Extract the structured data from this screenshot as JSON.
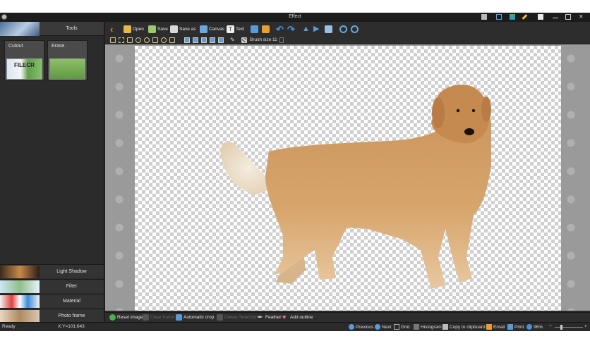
{
  "window": {
    "title": "Effect"
  },
  "sidebar": {
    "tools_label": "Tools",
    "cards": [
      {
        "label": "Cutout",
        "watermark": "FILECR"
      },
      {
        "label": "Erase"
      }
    ],
    "bottom_items": [
      {
        "label": "Light Shadow"
      },
      {
        "label": "Filter"
      },
      {
        "label": "Material"
      },
      {
        "label": "Photo frame"
      }
    ]
  },
  "toolbar": {
    "open": "Open",
    "save": "Save",
    "save_as": "Save as",
    "canvas": "Canvas",
    "text": "Text",
    "brush_size_label": "Brush size",
    "brush_size_value": "11"
  },
  "bottom_actions": {
    "reset": "Reset image",
    "clear_frame": "Clear frame",
    "auto_crop": "Automatic crop",
    "delete_selection": "Delete Selection",
    "feather": "Feather",
    "add_outline": "Add outline"
  },
  "status": {
    "ready": "Ready",
    "coords": "X:Y=101:643",
    "previous": "Previous",
    "next": "Next",
    "grid": "Grid",
    "histogram": "Histogram",
    "copy": "Copy to clipboard",
    "email": "Email",
    "print": "Print",
    "zoom": "96%",
    "zoom_level": 0.2
  },
  "colors": {
    "accent_orange": "#e08a2a",
    "blue_icon": "#4a8fd8",
    "bg": "#2a2a2a"
  }
}
